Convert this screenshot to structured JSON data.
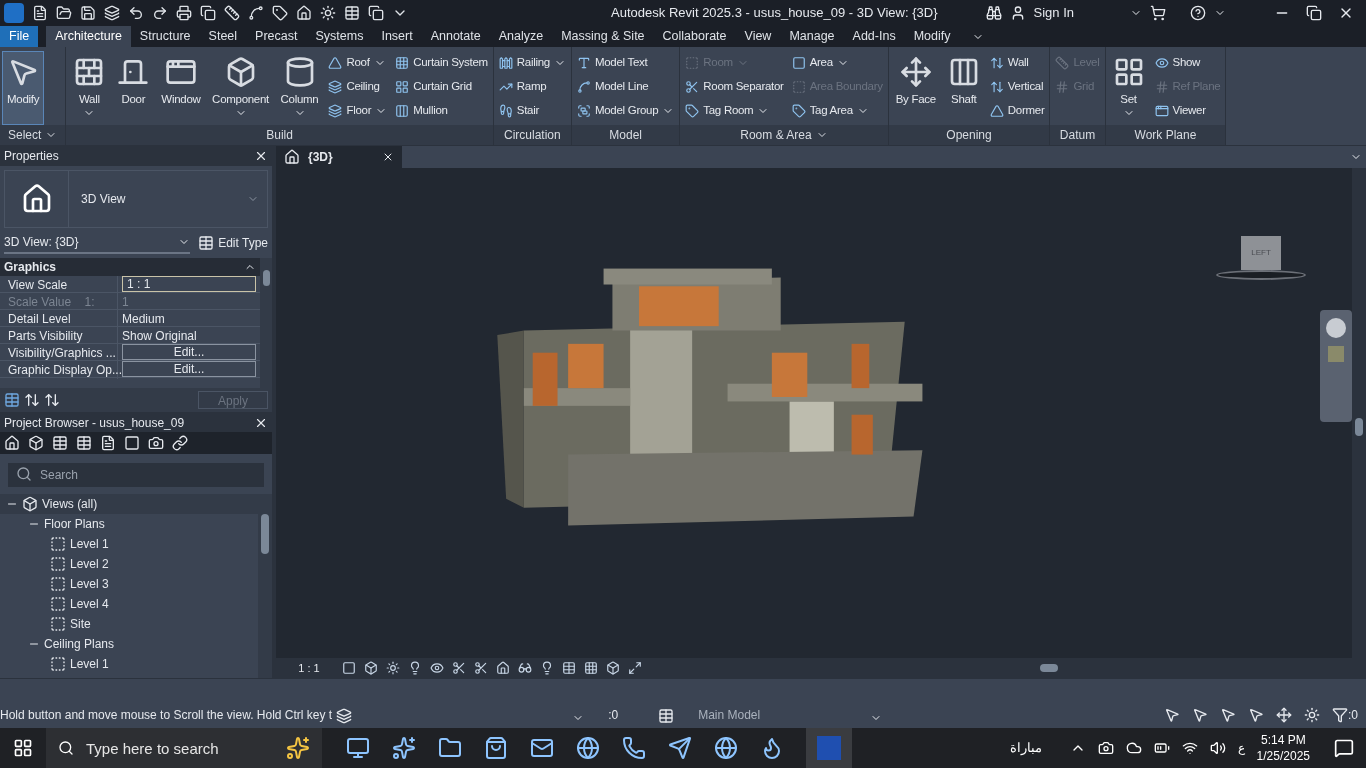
{
  "title_bar": {
    "title": "Autodesk Revit 2025.3 - usus_house_09 - 3D View: {3D}",
    "sign_in": "Sign In"
  },
  "menu_tabs": [
    {
      "label": "File",
      "kind": "file",
      "selected": false
    },
    {
      "label": "Architecture",
      "kind": "tab",
      "selected": true
    },
    {
      "label": "Structure",
      "kind": "tab",
      "selected": false
    },
    {
      "label": "Steel",
      "kind": "tab",
      "selected": false
    },
    {
      "label": "Precast",
      "kind": "tab",
      "selected": false
    },
    {
      "label": "Systems",
      "kind": "tab",
      "selected": false
    },
    {
      "label": "Insert",
      "kind": "tab",
      "selected": false
    },
    {
      "label": "Annotate",
      "kind": "tab",
      "selected": false
    },
    {
      "label": "Analyze",
      "kind": "tab",
      "selected": false
    },
    {
      "label": "Massing & Site",
      "kind": "tab",
      "selected": false
    },
    {
      "label": "Collaborate",
      "kind": "tab",
      "selected": false
    },
    {
      "label": "View",
      "kind": "tab",
      "selected": false
    },
    {
      "label": "Manage",
      "kind": "tab",
      "selected": false
    },
    {
      "label": "Add-Ins",
      "kind": "tab",
      "selected": false
    },
    {
      "label": "Modify",
      "kind": "tab",
      "selected": false
    }
  ],
  "ribbon": [
    {
      "title": "Select",
      "menu": true,
      "tools": [
        {
          "label": "Modify",
          "kind": "large",
          "dropdown": false,
          "disabled": false,
          "selected": true
        }
      ]
    },
    {
      "title": "Build",
      "menu": false,
      "tools": [
        {
          "label": "Wall",
          "kind": "large",
          "dropdown": true,
          "disabled": false,
          "selected": false
        },
        {
          "label": "Door",
          "kind": "large",
          "dropdown": false,
          "disabled": false,
          "selected": false
        },
        {
          "label": "Window",
          "kind": "large",
          "dropdown": false,
          "disabled": false,
          "selected": false
        },
        {
          "label": "Component",
          "kind": "large",
          "dropdown": true,
          "disabled": false,
          "selected": false
        },
        {
          "label": "Column",
          "kind": "large",
          "dropdown": true,
          "disabled": false,
          "selected": false
        },
        {
          "label": "Roof",
          "kind": "small",
          "dropdown": true,
          "disabled": false,
          "selected": false
        },
        {
          "label": "Ceiling",
          "kind": "small",
          "dropdown": false,
          "disabled": false,
          "selected": false
        },
        {
          "label": "Floor",
          "kind": "small",
          "dropdown": true,
          "disabled": false,
          "selected": false
        },
        {
          "label": "Curtain System",
          "kind": "small",
          "dropdown": false,
          "disabled": false,
          "selected": false
        },
        {
          "label": "Curtain Grid",
          "kind": "small",
          "dropdown": false,
          "disabled": false,
          "selected": false
        },
        {
          "label": "Mullion",
          "kind": "small",
          "dropdown": false,
          "disabled": false,
          "selected": false
        }
      ]
    },
    {
      "title": "Circulation",
      "menu": false,
      "tools": [
        {
          "label": "Railing",
          "kind": "small",
          "dropdown": true,
          "disabled": false,
          "selected": false
        },
        {
          "label": "Ramp",
          "kind": "small",
          "dropdown": false,
          "disabled": false,
          "selected": false
        },
        {
          "label": "Stair",
          "kind": "small",
          "dropdown": false,
          "disabled": false,
          "selected": false
        }
      ]
    },
    {
      "title": "Model",
      "menu": false,
      "tools": [
        {
          "label": "Model Text",
          "kind": "small",
          "dropdown": false,
          "disabled": false,
          "selected": false
        },
        {
          "label": "Model Line",
          "kind": "small",
          "dropdown": false,
          "disabled": false,
          "selected": false
        },
        {
          "label": "Model Group",
          "kind": "small",
          "dropdown": true,
          "disabled": false,
          "selected": false
        }
      ]
    },
    {
      "title": "Room & Area",
      "menu": true,
      "tools": [
        {
          "label": "Room",
          "kind": "small",
          "dropdown": true,
          "disabled": true,
          "selected": false
        },
        {
          "label": "Room Separator",
          "kind": "small",
          "dropdown": false,
          "disabled": false,
          "selected": false
        },
        {
          "label": "Tag Room",
          "kind": "small",
          "dropdown": true,
          "disabled": false,
          "selected": false
        },
        {
          "label": "Area",
          "kind": "small",
          "dropdown": true,
          "disabled": false,
          "selected": false
        },
        {
          "label": "Area Boundary",
          "kind": "small",
          "dropdown": false,
          "disabled": true,
          "selected": false
        },
        {
          "label": "Tag Area",
          "kind": "small",
          "dropdown": true,
          "disabled": false,
          "selected": false
        }
      ]
    },
    {
      "title": "Opening",
      "menu": false,
      "tools": [
        {
          "label": "By Face",
          "kind": "large",
          "dropdown": false,
          "disabled": false,
          "selected": false
        },
        {
          "label": "Shaft",
          "kind": "large",
          "dropdown": false,
          "disabled": false,
          "selected": false
        },
        {
          "label": "Wall",
          "kind": "small",
          "dropdown": false,
          "disabled": false,
          "selected": false
        },
        {
          "label": "Vertical",
          "kind": "small",
          "dropdown": false,
          "disabled": false,
          "selected": false
        },
        {
          "label": "Dormer",
          "kind": "small",
          "dropdown": false,
          "disabled": false,
          "selected": false
        }
      ]
    },
    {
      "title": "Datum",
      "menu": false,
      "tools": [
        {
          "label": "Level",
          "kind": "small",
          "dropdown": false,
          "disabled": true,
          "selected": false
        },
        {
          "label": "Grid",
          "kind": "small",
          "dropdown": false,
          "disabled": true,
          "selected": false
        }
      ]
    },
    {
      "title": "Work Plane",
      "menu": false,
      "tools": [
        {
          "label": "Set",
          "kind": "large",
          "dropdown": true,
          "disabled": false,
          "selected": false
        },
        {
          "label": "Show",
          "kind": "small",
          "dropdown": false,
          "disabled": false,
          "selected": false
        },
        {
          "label": "Ref Plane",
          "kind": "small",
          "dropdown": false,
          "disabled": true,
          "selected": false
        },
        {
          "label": "Viewer",
          "kind": "small",
          "dropdown": false,
          "disabled": false,
          "selected": false
        }
      ]
    }
  ],
  "properties": {
    "title": "Properties",
    "type_name": "3D View",
    "instance": "3D View: {3D}",
    "edit_type": "Edit Type",
    "group": "Graphics",
    "rows": [
      {
        "name": "View Scale",
        "value": "1 : 1",
        "kind": "field",
        "disabled": false
      },
      {
        "name": "Scale Value    1:",
        "value": "1",
        "kind": "text",
        "disabled": true
      },
      {
        "name": "Detail Level",
        "value": "Medium",
        "kind": "text",
        "disabled": false
      },
      {
        "name": "Parts Visibility",
        "value": "Show Original",
        "kind": "text",
        "disabled": false
      },
      {
        "name": "Visibility/Graphics ...",
        "value": "Edit...",
        "kind": "button",
        "disabled": false
      },
      {
        "name": "Graphic Display Op...",
        "value": "Edit...",
        "kind": "button",
        "disabled": false
      }
    ],
    "apply": {
      "label": "Apply",
      "disabled": true
    }
  },
  "project_browser": {
    "title": "Project Browser - usus_house_09",
    "search_placeholder": "Search",
    "tree": [
      {
        "label": "Views (all)",
        "kind": "root",
        "expanded": true,
        "children": [
          {
            "label": "Floor Plans",
            "kind": "group",
            "expanded": true,
            "children": [
              {
                "label": "Level 1",
                "kind": "view"
              },
              {
                "label": "Level 2",
                "kind": "view"
              },
              {
                "label": "Level 3",
                "kind": "view"
              },
              {
                "label": "Level 4",
                "kind": "view"
              },
              {
                "label": "Site",
                "kind": "view"
              }
            ]
          },
          {
            "label": "Ceiling Plans",
            "kind": "group",
            "expanded": true,
            "children": [
              {
                "label": "Level 1",
                "kind": "view"
              }
            ]
          }
        ]
      }
    ]
  },
  "view_tab": {
    "label": "{3D}"
  },
  "view_cube": {
    "face": "LEFT"
  },
  "view_bar": {
    "scale": "1 : 1"
  },
  "status_bar": {
    "message": "Hold button and move mouse to Scroll the view. Hold Ctrl key t",
    "worksets": ":0",
    "model": "Main Model",
    "filter": ":0"
  },
  "taskbar": {
    "search_placeholder": "Type here to search",
    "widget": "مباراة",
    "language": "ع",
    "time": "5:14 PM",
    "date": "1/25/2025"
  }
}
